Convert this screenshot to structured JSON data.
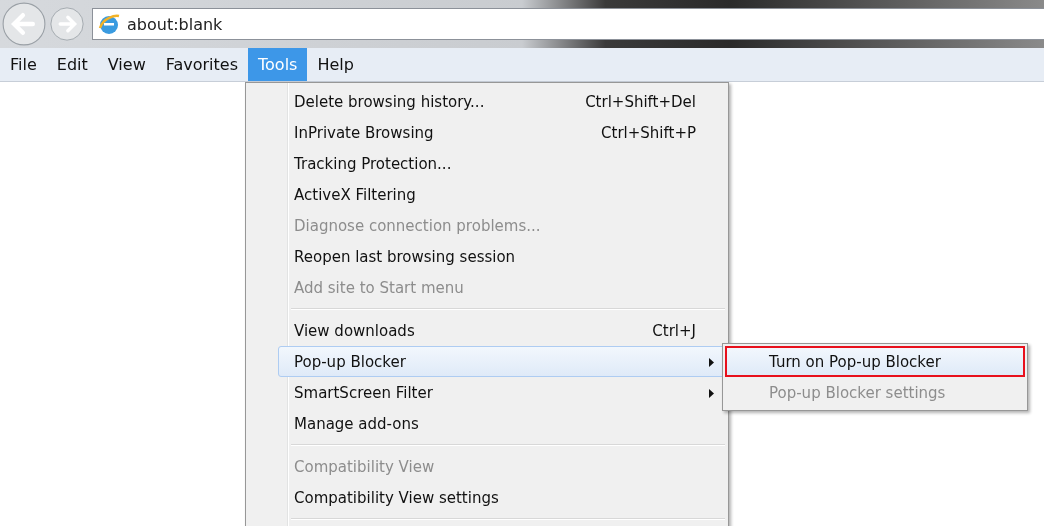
{
  "address_bar": {
    "value": "about:blank"
  },
  "menu_bar": [
    {
      "label": "File",
      "selected": false
    },
    {
      "label": "Edit",
      "selected": false
    },
    {
      "label": "View",
      "selected": false
    },
    {
      "label": "Favorites",
      "selected": false
    },
    {
      "label": "Tools",
      "selected": true
    },
    {
      "label": "Help",
      "selected": false
    }
  ],
  "tools_menu": {
    "items": [
      {
        "kind": "item",
        "label": "Delete browsing history...",
        "shortcut": "Ctrl+Shift+Del",
        "disabled": false,
        "selected": false,
        "has_submenu": false
      },
      {
        "kind": "item",
        "label": "InPrivate Browsing",
        "shortcut": "Ctrl+Shift+P",
        "disabled": false,
        "selected": false,
        "has_submenu": false
      },
      {
        "kind": "item",
        "label": "Tracking Protection...",
        "disabled": false,
        "selected": false,
        "has_submenu": false
      },
      {
        "kind": "item",
        "label": "ActiveX Filtering",
        "disabled": false,
        "selected": false,
        "has_submenu": false
      },
      {
        "kind": "item",
        "label": "Diagnose connection problems...",
        "disabled": true,
        "selected": false,
        "has_submenu": false
      },
      {
        "kind": "item",
        "label": "Reopen last browsing session",
        "disabled": false,
        "selected": false,
        "has_submenu": false
      },
      {
        "kind": "item",
        "label": "Add site to Start menu",
        "disabled": true,
        "selected": false,
        "has_submenu": false
      },
      {
        "kind": "separator"
      },
      {
        "kind": "item",
        "label": "View downloads",
        "shortcut": "Ctrl+J",
        "disabled": false,
        "selected": false,
        "has_submenu": false
      },
      {
        "kind": "item",
        "label": "Pop-up Blocker",
        "disabled": false,
        "selected": true,
        "has_submenu": true
      },
      {
        "kind": "item",
        "label": "SmartScreen Filter",
        "disabled": false,
        "selected": false,
        "has_submenu": true
      },
      {
        "kind": "item",
        "label": "Manage add-ons",
        "disabled": false,
        "selected": false,
        "has_submenu": false
      },
      {
        "kind": "separator"
      },
      {
        "kind": "item",
        "label": "Compatibility View",
        "disabled": true,
        "selected": false,
        "has_submenu": false
      },
      {
        "kind": "item",
        "label": "Compatibility View settings",
        "disabled": false,
        "selected": false,
        "has_submenu": false
      },
      {
        "kind": "separator"
      }
    ]
  },
  "popup_submenu": {
    "items": [
      {
        "label": "Turn on Pop-up Blocker",
        "disabled": false,
        "selected": true,
        "annotated": true
      },
      {
        "label": "Pop-up Blocker settings",
        "disabled": true,
        "selected": false,
        "annotated": false
      }
    ]
  }
}
